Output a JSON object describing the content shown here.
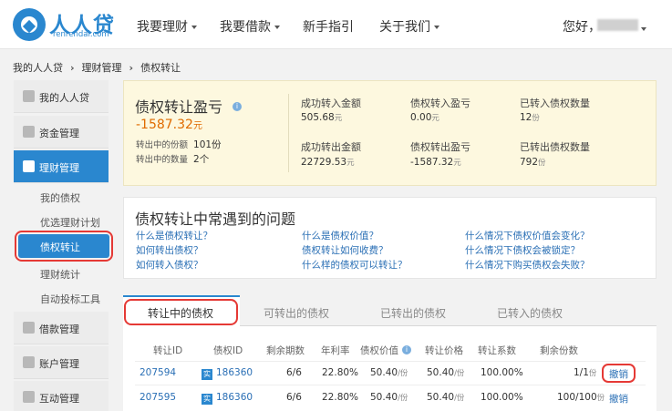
{
  "header": {
    "brand": "人人贷",
    "domain": "renrendai.com",
    "nav": [
      "我要理财",
      "我要借款",
      "新手指引",
      "关于我们"
    ],
    "greeting": "您好，"
  },
  "breadcrumb": [
    "我的人人贷",
    "理财管理",
    "债权转让"
  ],
  "sidebar": {
    "items": [
      "我的人人贷",
      "资金管理",
      "理财管理",
      "借款管理",
      "账户管理",
      "互动管理"
    ],
    "sub_items": [
      "我的债权",
      "优选理财计划",
      "债权转让",
      "理财统计",
      "自动投标工具"
    ]
  },
  "summary": {
    "title": "债权转让盈亏",
    "value": "-1587.32",
    "unit": "元",
    "transferring_shares_label": "转出中的份额",
    "transferring_shares": "101份",
    "transferring_count_label": "转出中的数量",
    "transferring_count": "2个",
    "stats": [
      {
        "label": "成功转入金额",
        "value": "505.68",
        "unit": "元"
      },
      {
        "label": "债权转入盈亏",
        "value": "0.00",
        "unit": "元"
      },
      {
        "label": "已转入债权数量",
        "value": "12",
        "unit": "份"
      },
      {
        "label": "成功转出金额",
        "value": "22729.53",
        "unit": "元"
      },
      {
        "label": "债权转出盈亏",
        "value": "-1587.32",
        "unit": "元"
      },
      {
        "label": "已转出债权数量",
        "value": "792",
        "unit": "份"
      }
    ]
  },
  "faq": {
    "title": "债权转让中常遇到的问题",
    "questions": [
      "什么是债权转让？",
      "什么是债权价值？",
      "什么情况下债权价值会变化？",
      "如何转出债权？",
      "债权转让如何收费？",
      "什么情况下债权会被锁定？",
      "如何转入债权？",
      "什么样的债权可以转让？",
      "什么情况下购买债权会失败？"
    ]
  },
  "tabs": [
    "转让中的债权",
    "可转出的债权",
    "已转出的债权",
    "已转入的债权"
  ],
  "table": {
    "headers": [
      "转让ID",
      "债权ID",
      "剩余期数",
      "年利率",
      "债权价值",
      "转让价格",
      "转让系数",
      "剩余份数"
    ],
    "rows": [
      {
        "transfer_id": "207594",
        "badge": "实",
        "debt_id": "186360",
        "periods": "6/6",
        "rate": "22.80%",
        "value": "50.40",
        "value_unit": "/份",
        "price": "50.40",
        "price_unit": "/份",
        "coef": "100.00%",
        "remain": "1/1",
        "remain_unit": "份",
        "action": "撤销"
      },
      {
        "transfer_id": "207595",
        "badge": "实",
        "debt_id": "186360",
        "periods": "6/6",
        "rate": "22.80%",
        "value": "50.40",
        "value_unit": "/份",
        "price": "50.40",
        "price_unit": "/份",
        "coef": "100.00%",
        "remain": "100/100",
        "remain_unit": "份",
        "action": "撤销"
      }
    ]
  },
  "colors": {
    "accent": "#2a87cf",
    "highlight": "#e53935",
    "negative": "#e06b00"
  }
}
